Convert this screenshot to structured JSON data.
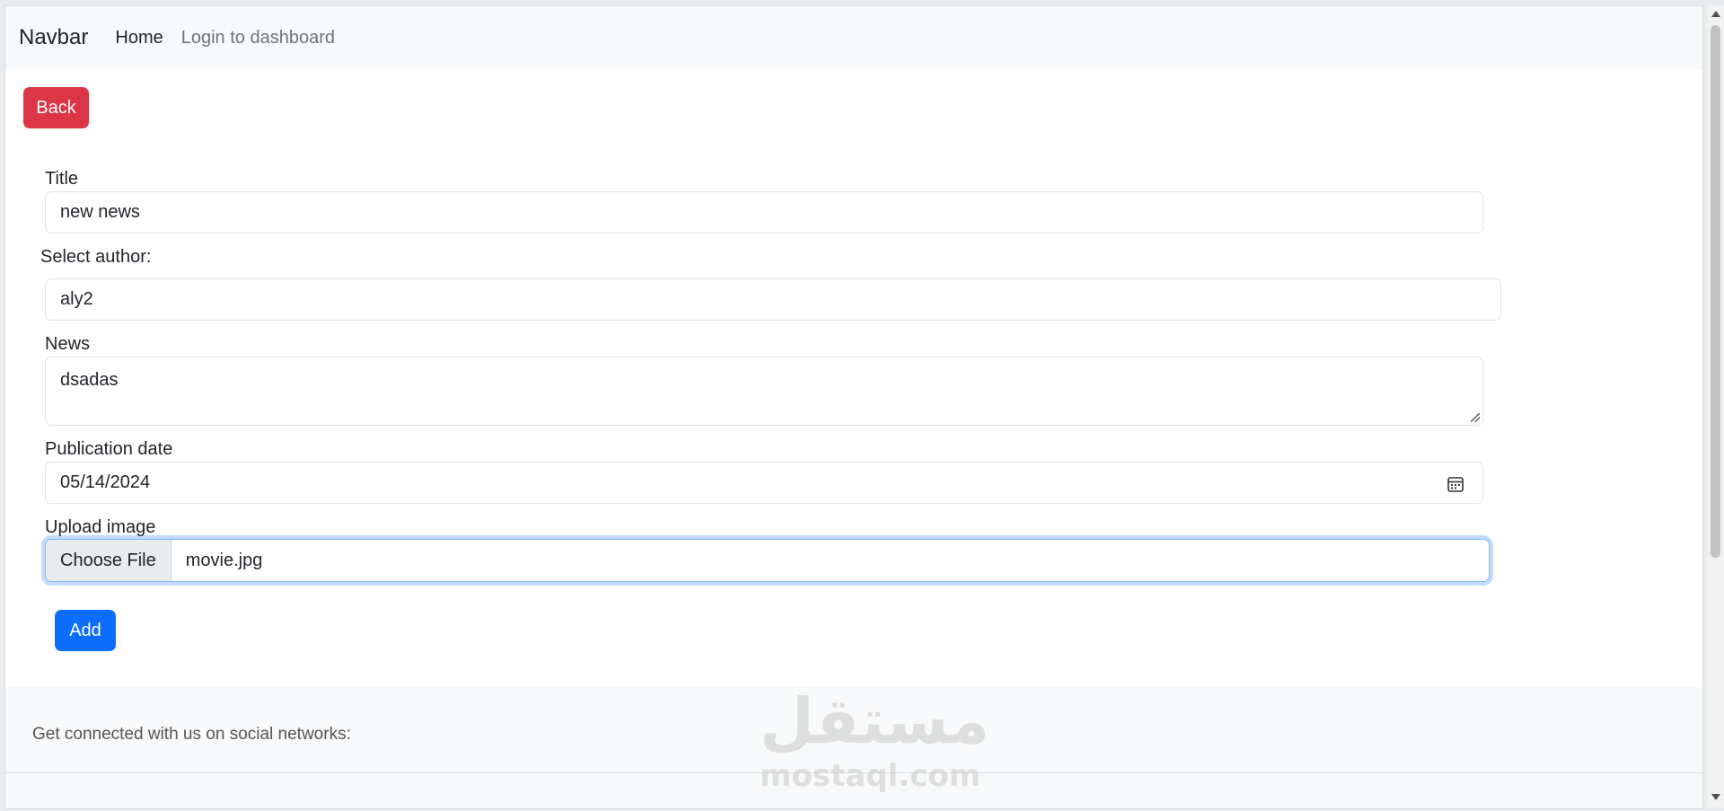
{
  "navbar": {
    "brand": "Navbar",
    "links": [
      {
        "label": "Home"
      },
      {
        "label": "Login to dashboard"
      }
    ]
  },
  "back_button": {
    "label": "Back",
    "color": "#dc3545"
  },
  "form": {
    "title": {
      "label": "Title",
      "value": "new news"
    },
    "author": {
      "label": "Select author:",
      "value": "aly2"
    },
    "news": {
      "label": "News",
      "value": "dsadas"
    },
    "publication_date": {
      "label": "Publication date",
      "value": "05/14/2024",
      "icon": "calendar-icon"
    },
    "upload_image": {
      "label": "Upload image",
      "button_label": "Choose File",
      "file_name": "movie.jpg"
    }
  },
  "add_button": {
    "label": "Add",
    "color": "#0d6efd"
  },
  "footer": {
    "text": "Get connected with us on social networks:"
  },
  "watermark": {
    "logo": "مستقل",
    "url": "mostaql.com"
  }
}
